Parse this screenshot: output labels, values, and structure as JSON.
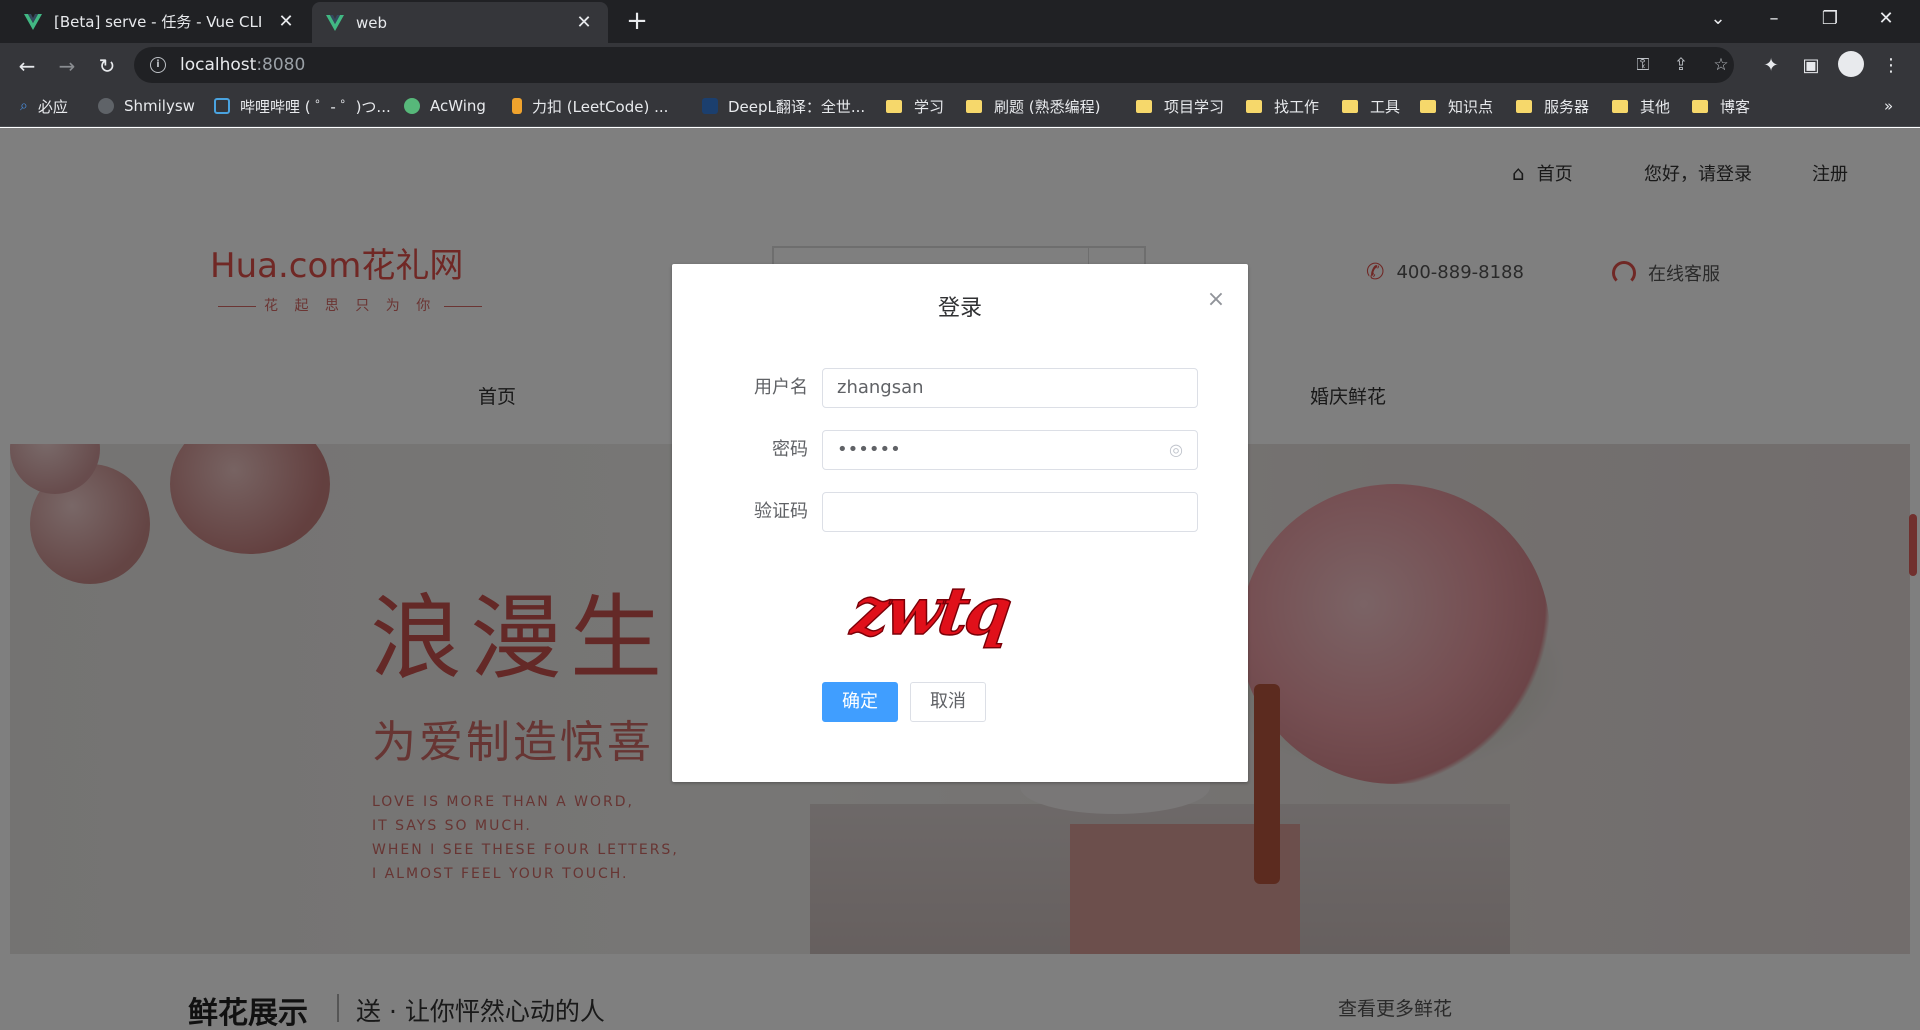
{
  "browser": {
    "tabs": [
      {
        "title": "[Beta] serve - 任务 - Vue CLI",
        "active": false
      },
      {
        "title": "web",
        "active": true
      }
    ],
    "url_host": "localhost",
    "url_port": ":8080",
    "bookmarks": [
      {
        "label": "必应",
        "icon": "search-icon"
      },
      {
        "label": "Shmilysw",
        "icon": "github-icon"
      },
      {
        "label": "哔哩哔哩 ( ゜- ゜)つ...",
        "icon": "bilibili-icon"
      },
      {
        "label": "AcWing",
        "icon": "acwing-icon"
      },
      {
        "label": "力扣 (LeetCode) ...",
        "icon": "leetcode-icon"
      },
      {
        "label": "DeepL翻译：全世...",
        "icon": "deepl-icon"
      },
      {
        "label": "学习",
        "icon": "folder-icon"
      },
      {
        "label": "刷题 (熟悉编程)",
        "icon": "folder-icon"
      },
      {
        "label": "项目学习",
        "icon": "folder-icon"
      },
      {
        "label": "找工作",
        "icon": "folder-icon"
      },
      {
        "label": "工具",
        "icon": "folder-icon"
      },
      {
        "label": "知识点",
        "icon": "folder-icon"
      },
      {
        "label": "服务器",
        "icon": "folder-icon"
      },
      {
        "label": "其他",
        "icon": "folder-icon"
      },
      {
        "label": "博客",
        "icon": "folder-icon"
      }
    ],
    "more_bookmarks": "»"
  },
  "header": {
    "home_link": "首页",
    "login_link": "您好，请登录",
    "register_link": "注册",
    "logo_main": "Hua.com花礼网",
    "logo_sub": "花 起 思 只 为 你",
    "hotline": "400-889-8188",
    "service": "在线客服"
  },
  "nav": {
    "items": [
      "首页",
      "婚庆鲜花"
    ]
  },
  "banner": {
    "title": "浪漫生",
    "subtitle": "为爱制造惊喜",
    "english_lines": [
      "LOVE IS MORE THAN A WORD,",
      "IT SAYS SO MUCH.",
      "WHEN I SEE THESE FOUR LETTERS,",
      "I ALMOST FEEL YOUR TOUCH."
    ]
  },
  "section": {
    "title": "鲜花展示",
    "subtitle": "送 · 让你怦然心动的人",
    "more": "查看更多鲜花"
  },
  "dialog": {
    "title": "登录",
    "username_label": "用户名",
    "username_value": "zhangsan",
    "password_label": "密码",
    "password_value": "••••••",
    "captcha_label": "验证码",
    "captcha_value": "",
    "captcha_image_text": "zwtq",
    "confirm_label": "确定",
    "cancel_label": "取消"
  },
  "colors": {
    "brand": "#e0504b",
    "primary_button": "#409eff",
    "chrome_dark": "#202124",
    "chrome_toolbar": "#35363a",
    "captcha_red": "#e0101a"
  }
}
